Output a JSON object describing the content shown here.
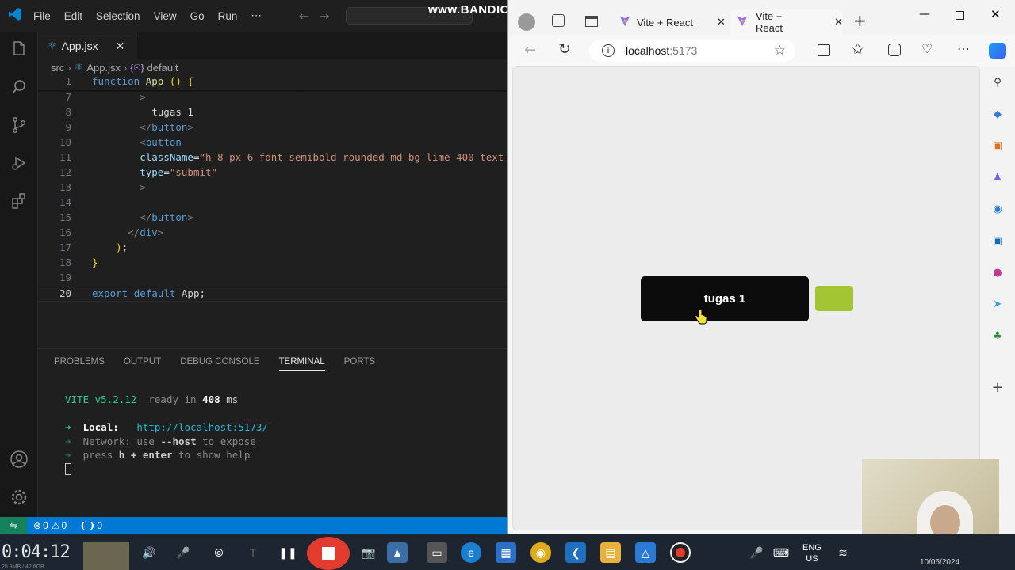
{
  "watermark": "www.BANDICAM.com",
  "vscode": {
    "menu": [
      "File",
      "Edit",
      "Selection",
      "View",
      "Go",
      "Run",
      "⋯"
    ],
    "tab_label": "App.jsx",
    "breadcrumb": [
      "src",
      "App.jsx",
      "default"
    ],
    "breadcrumb_prefix": "{☉}",
    "code": [
      {
        "n": "1",
        "parts": [
          [
            "kw",
            "function "
          ],
          [
            "fn",
            "App"
          ],
          [
            "tx",
            " "
          ],
          [
            "pn",
            "()"
          ],
          [
            "tx",
            " "
          ],
          [
            "pn",
            "{"
          ]
        ]
      },
      {
        "n": "7",
        "parts": [
          [
            "tx",
            "        "
          ],
          [
            "tg",
            ">"
          ]
        ]
      },
      {
        "n": "8",
        "parts": [
          [
            "tx",
            "          tugas 1"
          ]
        ]
      },
      {
        "n": "9",
        "parts": [
          [
            "tx",
            "        "
          ],
          [
            "tg",
            "</"
          ],
          [
            "tgn",
            "button"
          ],
          [
            "tg",
            ">"
          ]
        ]
      },
      {
        "n": "10",
        "parts": [
          [
            "tx",
            "        "
          ],
          [
            "tg",
            "<"
          ],
          [
            "tgn",
            "button"
          ]
        ]
      },
      {
        "n": "11",
        "parts": [
          [
            "tx",
            "        "
          ],
          [
            "at",
            "className"
          ],
          [
            "tx",
            "="
          ],
          [
            "st",
            "\"h-8 px-6 font-semibold rounded-md bg-lime-400 text-"
          ]
        ]
      },
      {
        "n": "12",
        "parts": [
          [
            "tx",
            "        "
          ],
          [
            "at",
            "type"
          ],
          [
            "tx",
            "="
          ],
          [
            "st",
            "\"submit\""
          ]
        ]
      },
      {
        "n": "13",
        "parts": [
          [
            "tx",
            "        "
          ],
          [
            "tg",
            ">"
          ]
        ]
      },
      {
        "n": "14",
        "parts": [
          [
            "tx",
            ""
          ]
        ]
      },
      {
        "n": "15",
        "parts": [
          [
            "tx",
            "        "
          ],
          [
            "tg",
            "</"
          ],
          [
            "tgn",
            "button"
          ],
          [
            "tg",
            ">"
          ]
        ]
      },
      {
        "n": "16",
        "parts": [
          [
            "tx",
            "      "
          ],
          [
            "tg",
            "</"
          ],
          [
            "tgn",
            "div"
          ],
          [
            "tg",
            ">"
          ]
        ]
      },
      {
        "n": "17",
        "parts": [
          [
            "tx",
            "    "
          ],
          [
            "pn",
            ")"
          ],
          [
            "tx",
            ";"
          ]
        ]
      },
      {
        "n": "18",
        "parts": [
          [
            "pn",
            "}"
          ]
        ]
      },
      {
        "n": "19",
        "parts": [
          [
            "tx",
            ""
          ]
        ]
      },
      {
        "n": "20",
        "parts": [
          [
            "kw",
            "export "
          ],
          [
            "kw",
            "default "
          ],
          [
            "tx",
            "App;"
          ]
        ]
      }
    ],
    "panel_tabs": [
      "PROBLEMS",
      "OUTPUT",
      "DEBUG CONSOLE",
      "TERMINAL",
      "PORTS"
    ],
    "panel_active": "TERMINAL",
    "terminal": {
      "vite": "VITE v5.2.12",
      "ready": "ready in",
      "ms_value": "408",
      "ms_unit": "ms",
      "local_label": "Local:",
      "local_url": "http://localhost:5173/",
      "network_line": "Network: use",
      "network_flag": "--host",
      "network_rest": "to expose",
      "help_a": "press",
      "help_b": "h + enter",
      "help_c": "to show help",
      "arrow": "➜"
    },
    "status": {
      "errors": "0",
      "warnings": "0",
      "ports": "0"
    }
  },
  "browser": {
    "tabs": [
      "Vite + React",
      "Vite + React"
    ],
    "url_host": "localhost",
    "url_port": ":5173",
    "button1_label": "tugas 1",
    "button2_color": "#a3c533"
  },
  "taskbar": {
    "timer": "0:04:12",
    "lang_top": "ENG",
    "lang_bottom": "US",
    "date": "10/06/2024",
    "mem": "25.9MB / 42.6GB"
  }
}
